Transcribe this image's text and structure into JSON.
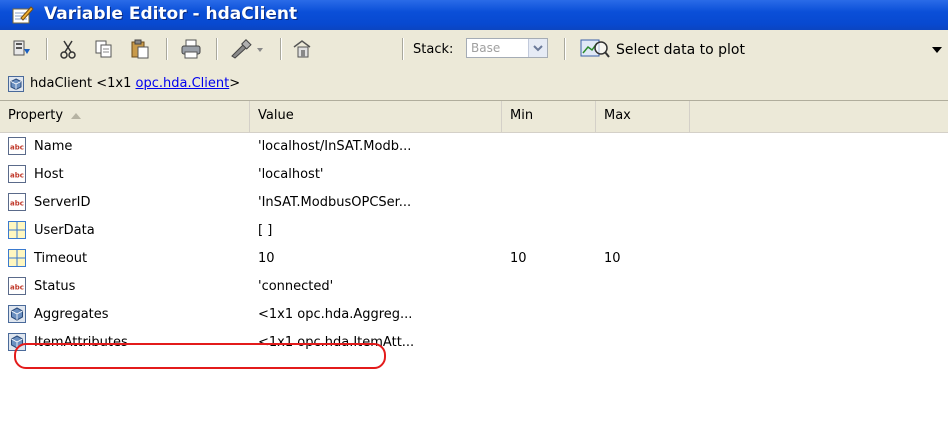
{
  "window": {
    "title": "Variable Editor - hdaClient"
  },
  "toolbar": {
    "stack_label": "Stack:",
    "stack_value": "Base",
    "plot_label": "Select data to plot",
    "buttons": [
      "import-data",
      "cut",
      "copy",
      "paste",
      "print",
      "brush",
      "new-plot-variable"
    ]
  },
  "variable_bar": {
    "prefix": "hdaClient <1x1 ",
    "class_link": "opc.hda.Client",
    "suffix": ">"
  },
  "table": {
    "headers": {
      "property": "Property",
      "value": "Value",
      "min": "Min",
      "max": "Max"
    },
    "rows": [
      {
        "icon": "abc",
        "name": "Name",
        "value": "'localhost/InSAT.Modb...",
        "min": "",
        "max": ""
      },
      {
        "icon": "abc",
        "name": "Host",
        "value": "'localhost'",
        "min": "",
        "max": ""
      },
      {
        "icon": "abc",
        "name": "ServerID",
        "value": "'InSAT.ModbusOPCSer...",
        "min": "",
        "max": ""
      },
      {
        "icon": "grid",
        "name": "UserData",
        "value": "[ ]",
        "min": "",
        "max": ""
      },
      {
        "icon": "grid",
        "name": "Timeout",
        "value": "10",
        "min": "10",
        "max": "10"
      },
      {
        "icon": "abc",
        "name": "Status",
        "value": "'connected'",
        "min": "",
        "max": ""
      },
      {
        "icon": "object",
        "name": "Aggregates",
        "value": "<1x1 opc.hda.Aggreg...",
        "min": "",
        "max": ""
      },
      {
        "icon": "object",
        "name": "ItemAttributes",
        "value": "<1x1 opc.hda.ItemAtt...",
        "min": "",
        "max": ""
      }
    ]
  },
  "colors": {
    "title_bar": "#0a4fd8",
    "highlight": "#e31b1b",
    "link": "#0000ee",
    "chrome": "#ece9d8"
  }
}
